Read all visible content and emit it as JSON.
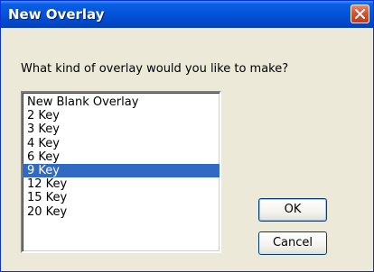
{
  "window": {
    "title": "New Overlay",
    "close_icon": "close-icon"
  },
  "prompt": "What kind of overlay would you like to make?",
  "overlay_list": {
    "selected_index": 5,
    "items": [
      "New Blank Overlay",
      "2 Key",
      "3 Key",
      "4 Key",
      "6 Key",
      "9 Key",
      "12 Key",
      "15 Key",
      "20 Key"
    ]
  },
  "buttons": {
    "ok_label": "OK",
    "cancel_label": "Cancel"
  },
  "colors": {
    "titlebar": "#0453d8",
    "selection": "#316ac5",
    "close_button": "#d9512c"
  }
}
